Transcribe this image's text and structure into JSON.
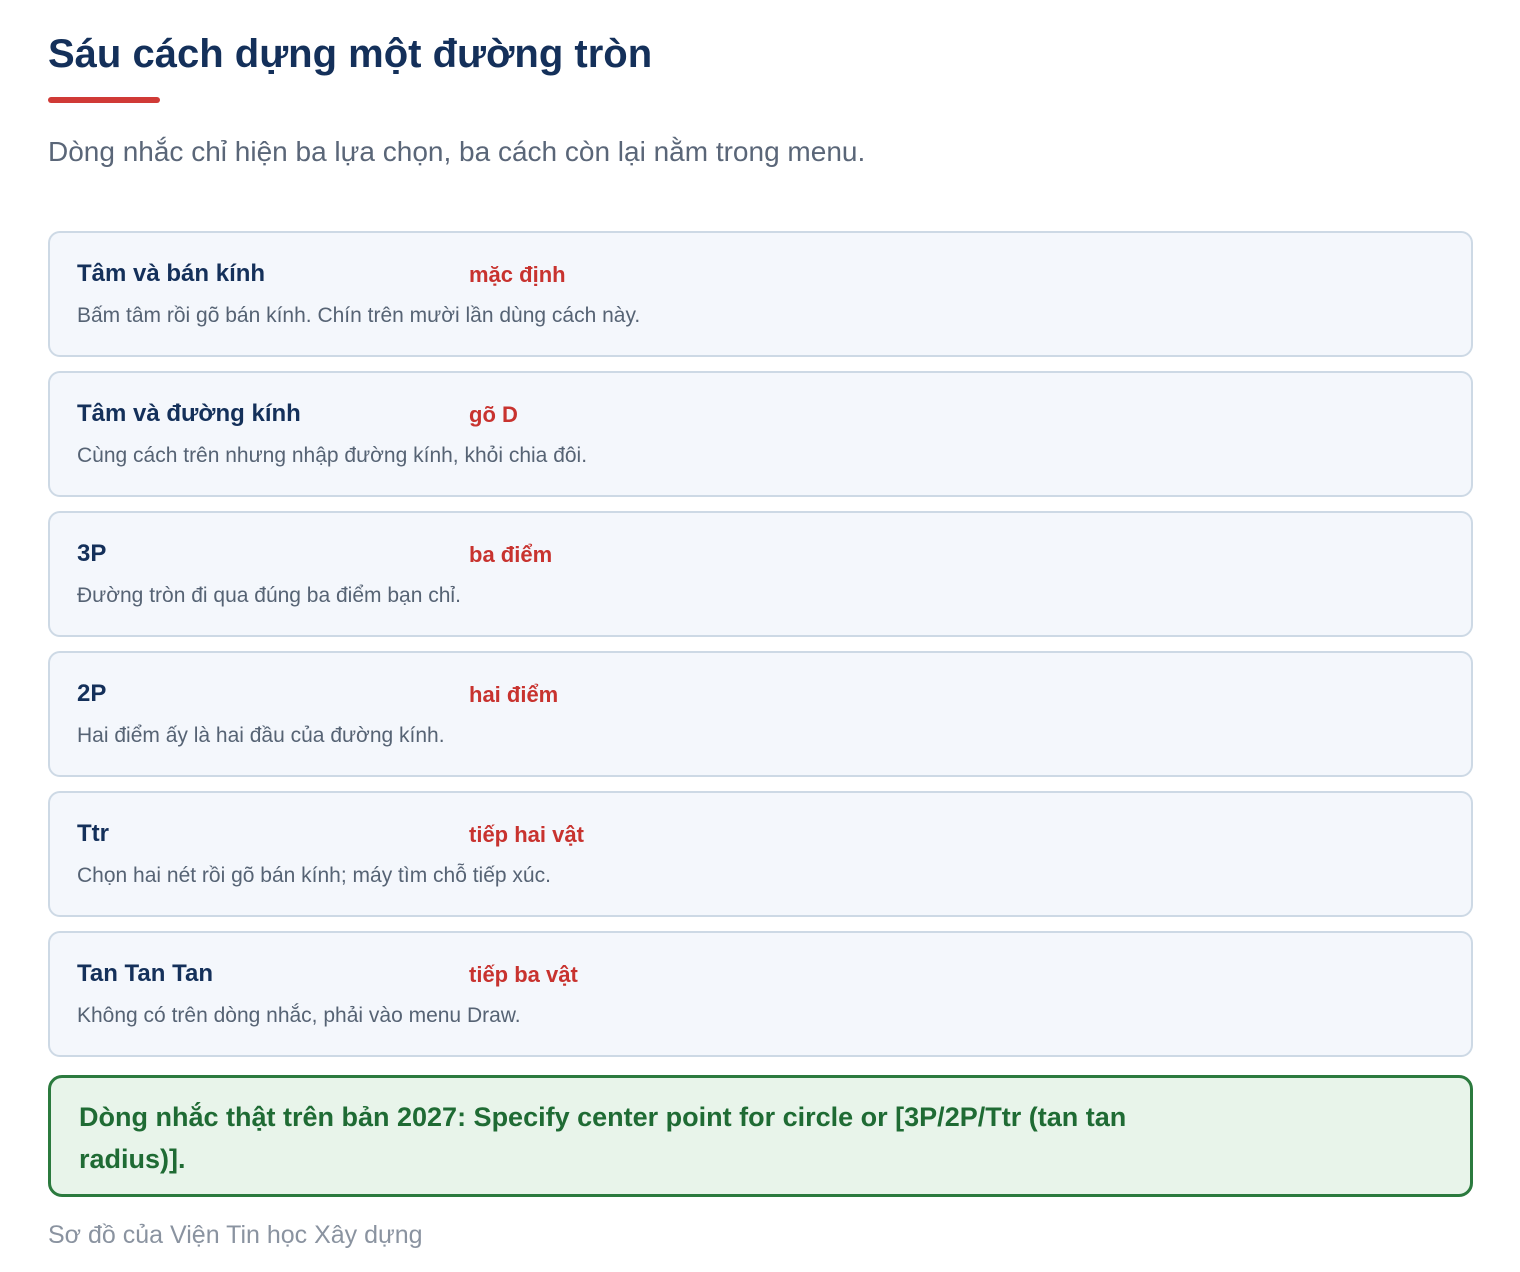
{
  "header": {
    "title": "Sáu cách dựng một đường tròn",
    "subtitle": "Dòng nhắc chỉ hiện ba lựa chọn, ba cách còn lại nằm trong menu."
  },
  "methods": [
    {
      "name": "Tâm và bán kính",
      "tag": "mặc định",
      "desc": "Bấm tâm rồi gõ bán kính. Chín trên mười lần dùng cách này."
    },
    {
      "name": "Tâm và đường kính",
      "tag": "gõ D",
      "desc": "Cùng cách trên nhưng nhập đường kính, khỏi chia đôi."
    },
    {
      "name": "3P",
      "tag": "ba điểm",
      "desc": "Đường tròn đi qua đúng ba điểm bạn chỉ."
    },
    {
      "name": "2P",
      "tag": "hai điểm",
      "desc": "Hai điểm ấy là hai đầu của đường kính."
    },
    {
      "name": "Ttr",
      "tag": "tiếp hai vật",
      "desc": "Chọn hai nét rồi gõ bán kính; máy tìm chỗ tiếp xúc."
    },
    {
      "name": "Tan Tan Tan",
      "tag": "tiếp ba vật",
      "desc": "Không có trên dòng nhắc, phải vào menu Draw."
    }
  ],
  "prompt_note": "Dòng nhắc thật trên bản 2027: Specify center point for circle or [3P/2P/Ttr (tan tan radius)].",
  "footer": "Sơ đồ của Viện Tin học Xây dựng",
  "colors": {
    "title": "#14305a",
    "accent_red": "#c8332f",
    "card_bg": "#f4f7fc",
    "card_border": "#cdd9e5",
    "note_green": "#2b7a3e",
    "note_bg": "#e8f4ea"
  }
}
